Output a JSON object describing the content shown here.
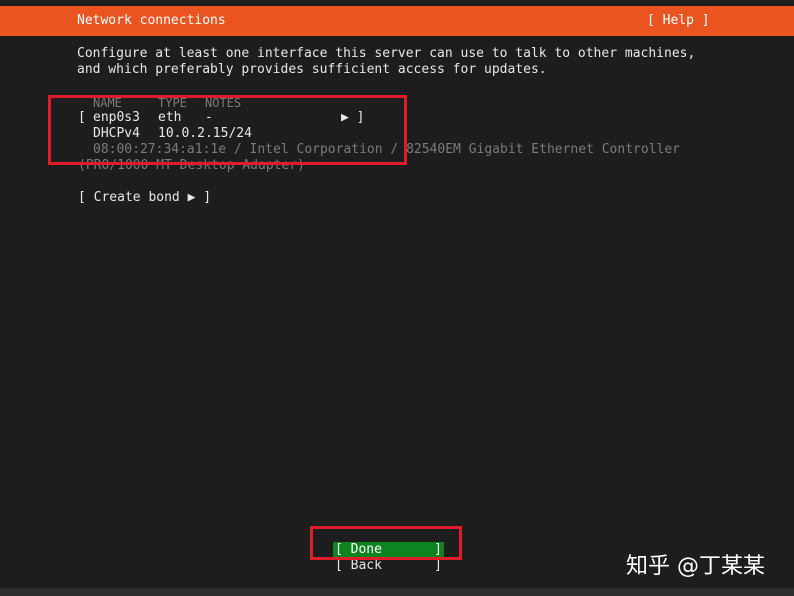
{
  "header": {
    "title": "Network connections",
    "help_label": "[ Help ]"
  },
  "intro": {
    "line1": "Configure at least one interface this server can use to talk to other machines,",
    "line2": "and which preferably provides sufficient access for updates."
  },
  "table": {
    "headers": {
      "name": "NAME",
      "type": "TYPE",
      "notes": "NOTES"
    },
    "interface": {
      "open_bracket": "[",
      "name": "enp0s3",
      "type": "eth",
      "notes": "-",
      "arrow": "▶ ]"
    },
    "address": {
      "method": "DHCPv4",
      "ip": "10.0.2.15/24"
    },
    "hw_line1": "08:00:27:34:a1:1e / Intel Corporation / 82540EM Gigabit Ethernet Controller",
    "hw_line2": "(PRO/1000 MT Desktop Adapter)"
  },
  "create_bond_label": "[ Create bond ▶ ]",
  "buttons": {
    "done": {
      "open": "[ Done",
      "close": "]"
    },
    "back": {
      "open": "[ Back",
      "close": "]"
    }
  },
  "watermark": "知乎 @丁某某",
  "colors": {
    "accent": "#e95420",
    "done_bg": "#0e8420",
    "highlight_box": "#e01b2a"
  }
}
